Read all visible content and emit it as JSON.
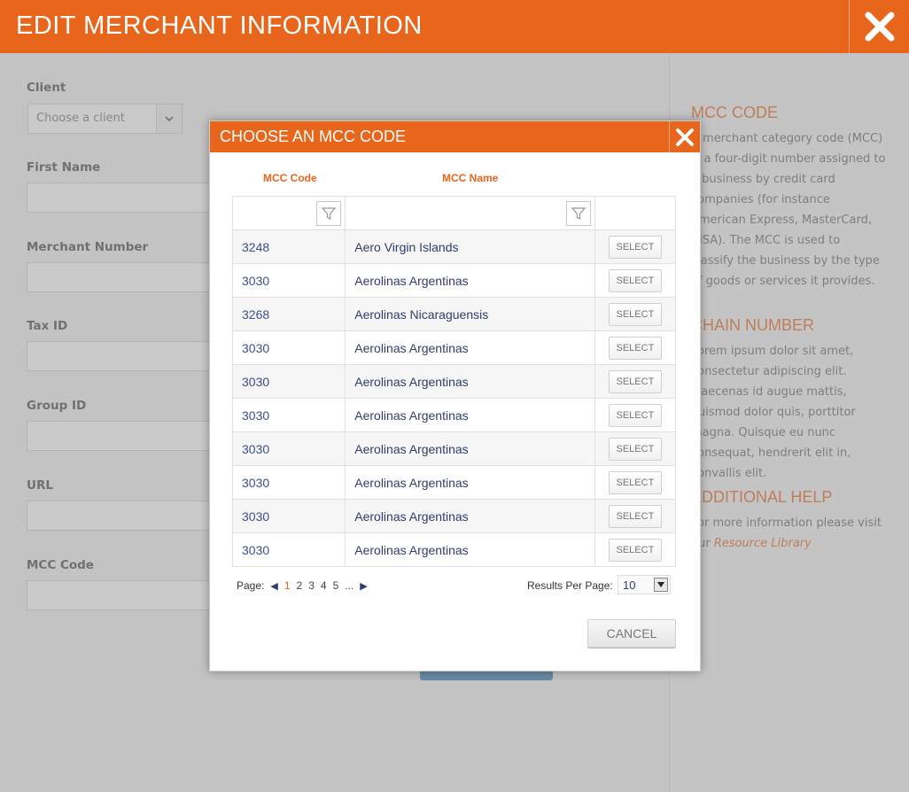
{
  "header": {
    "title": "EDIT MERCHANT INFORMATION"
  },
  "form": {
    "client_label": "Client",
    "client_placeholder": "Choose a client",
    "first_name_label": "First Name",
    "merchant_number_label": "Merchant Number",
    "tax_id_label": "Tax ID",
    "group_id_label": "Group ID",
    "url_label": "URL",
    "mcc_code_label": "MCC Code"
  },
  "help": {
    "mcc_title": "MCC CODE",
    "mcc_text": "A merchant category code (MCC) is a four-digit number assigned to a business by credit card companies (for instance American Express, MasterCard, VISA). The MCC is used to classify the business by the type of goods or services it provides.",
    "chain_title": "CHAIN NUMBER",
    "chain_text": "Lorem ipsum dolor sit amet, consectetur adipiscing elit. Maecenas id augue mattis, euismod dolor quis, porttitor magna. Quisque eu nunc consequat, hendrerit elit in, convallis elit.",
    "additional_title": "ADDITIONAL HELP",
    "additional_text": "For more information please visit our",
    "resource_link": "Resource Library"
  },
  "modal": {
    "title": "CHOOSE AN MCC CODE",
    "col_code": "MCC Code",
    "col_name": "MCC Name",
    "select_label": "SELECT",
    "rows": [
      {
        "code": "3248",
        "name": "Aero Virgin Islands"
      },
      {
        "code": "3030",
        "name": "Aerolinas Argentinas"
      },
      {
        "code": "3268",
        "name": "Aerolinas Nicaraguensis"
      },
      {
        "code": "3030",
        "name": "Aerolinas Argentinas"
      },
      {
        "code": "3030",
        "name": "Aerolinas Argentinas"
      },
      {
        "code": "3030",
        "name": "Aerolinas Argentinas"
      },
      {
        "code": "3030",
        "name": "Aerolinas Argentinas"
      },
      {
        "code": "3030",
        "name": "Aerolinas Argentinas"
      },
      {
        "code": "3030",
        "name": "Aerolinas Argentinas"
      },
      {
        "code": "3030",
        "name": "Aerolinas Argentinas"
      }
    ],
    "pager": {
      "label": "Page:",
      "pages": [
        "1",
        "2",
        "3",
        "4",
        "5"
      ],
      "ellipsis": "...",
      "current": "1"
    },
    "results_per_page_label": "Results Per Page:",
    "results_per_page_value": "10",
    "cancel_label": "CANCEL"
  },
  "colors": {
    "accent": "#e8651c",
    "link_blue": "#2f3d6b"
  }
}
